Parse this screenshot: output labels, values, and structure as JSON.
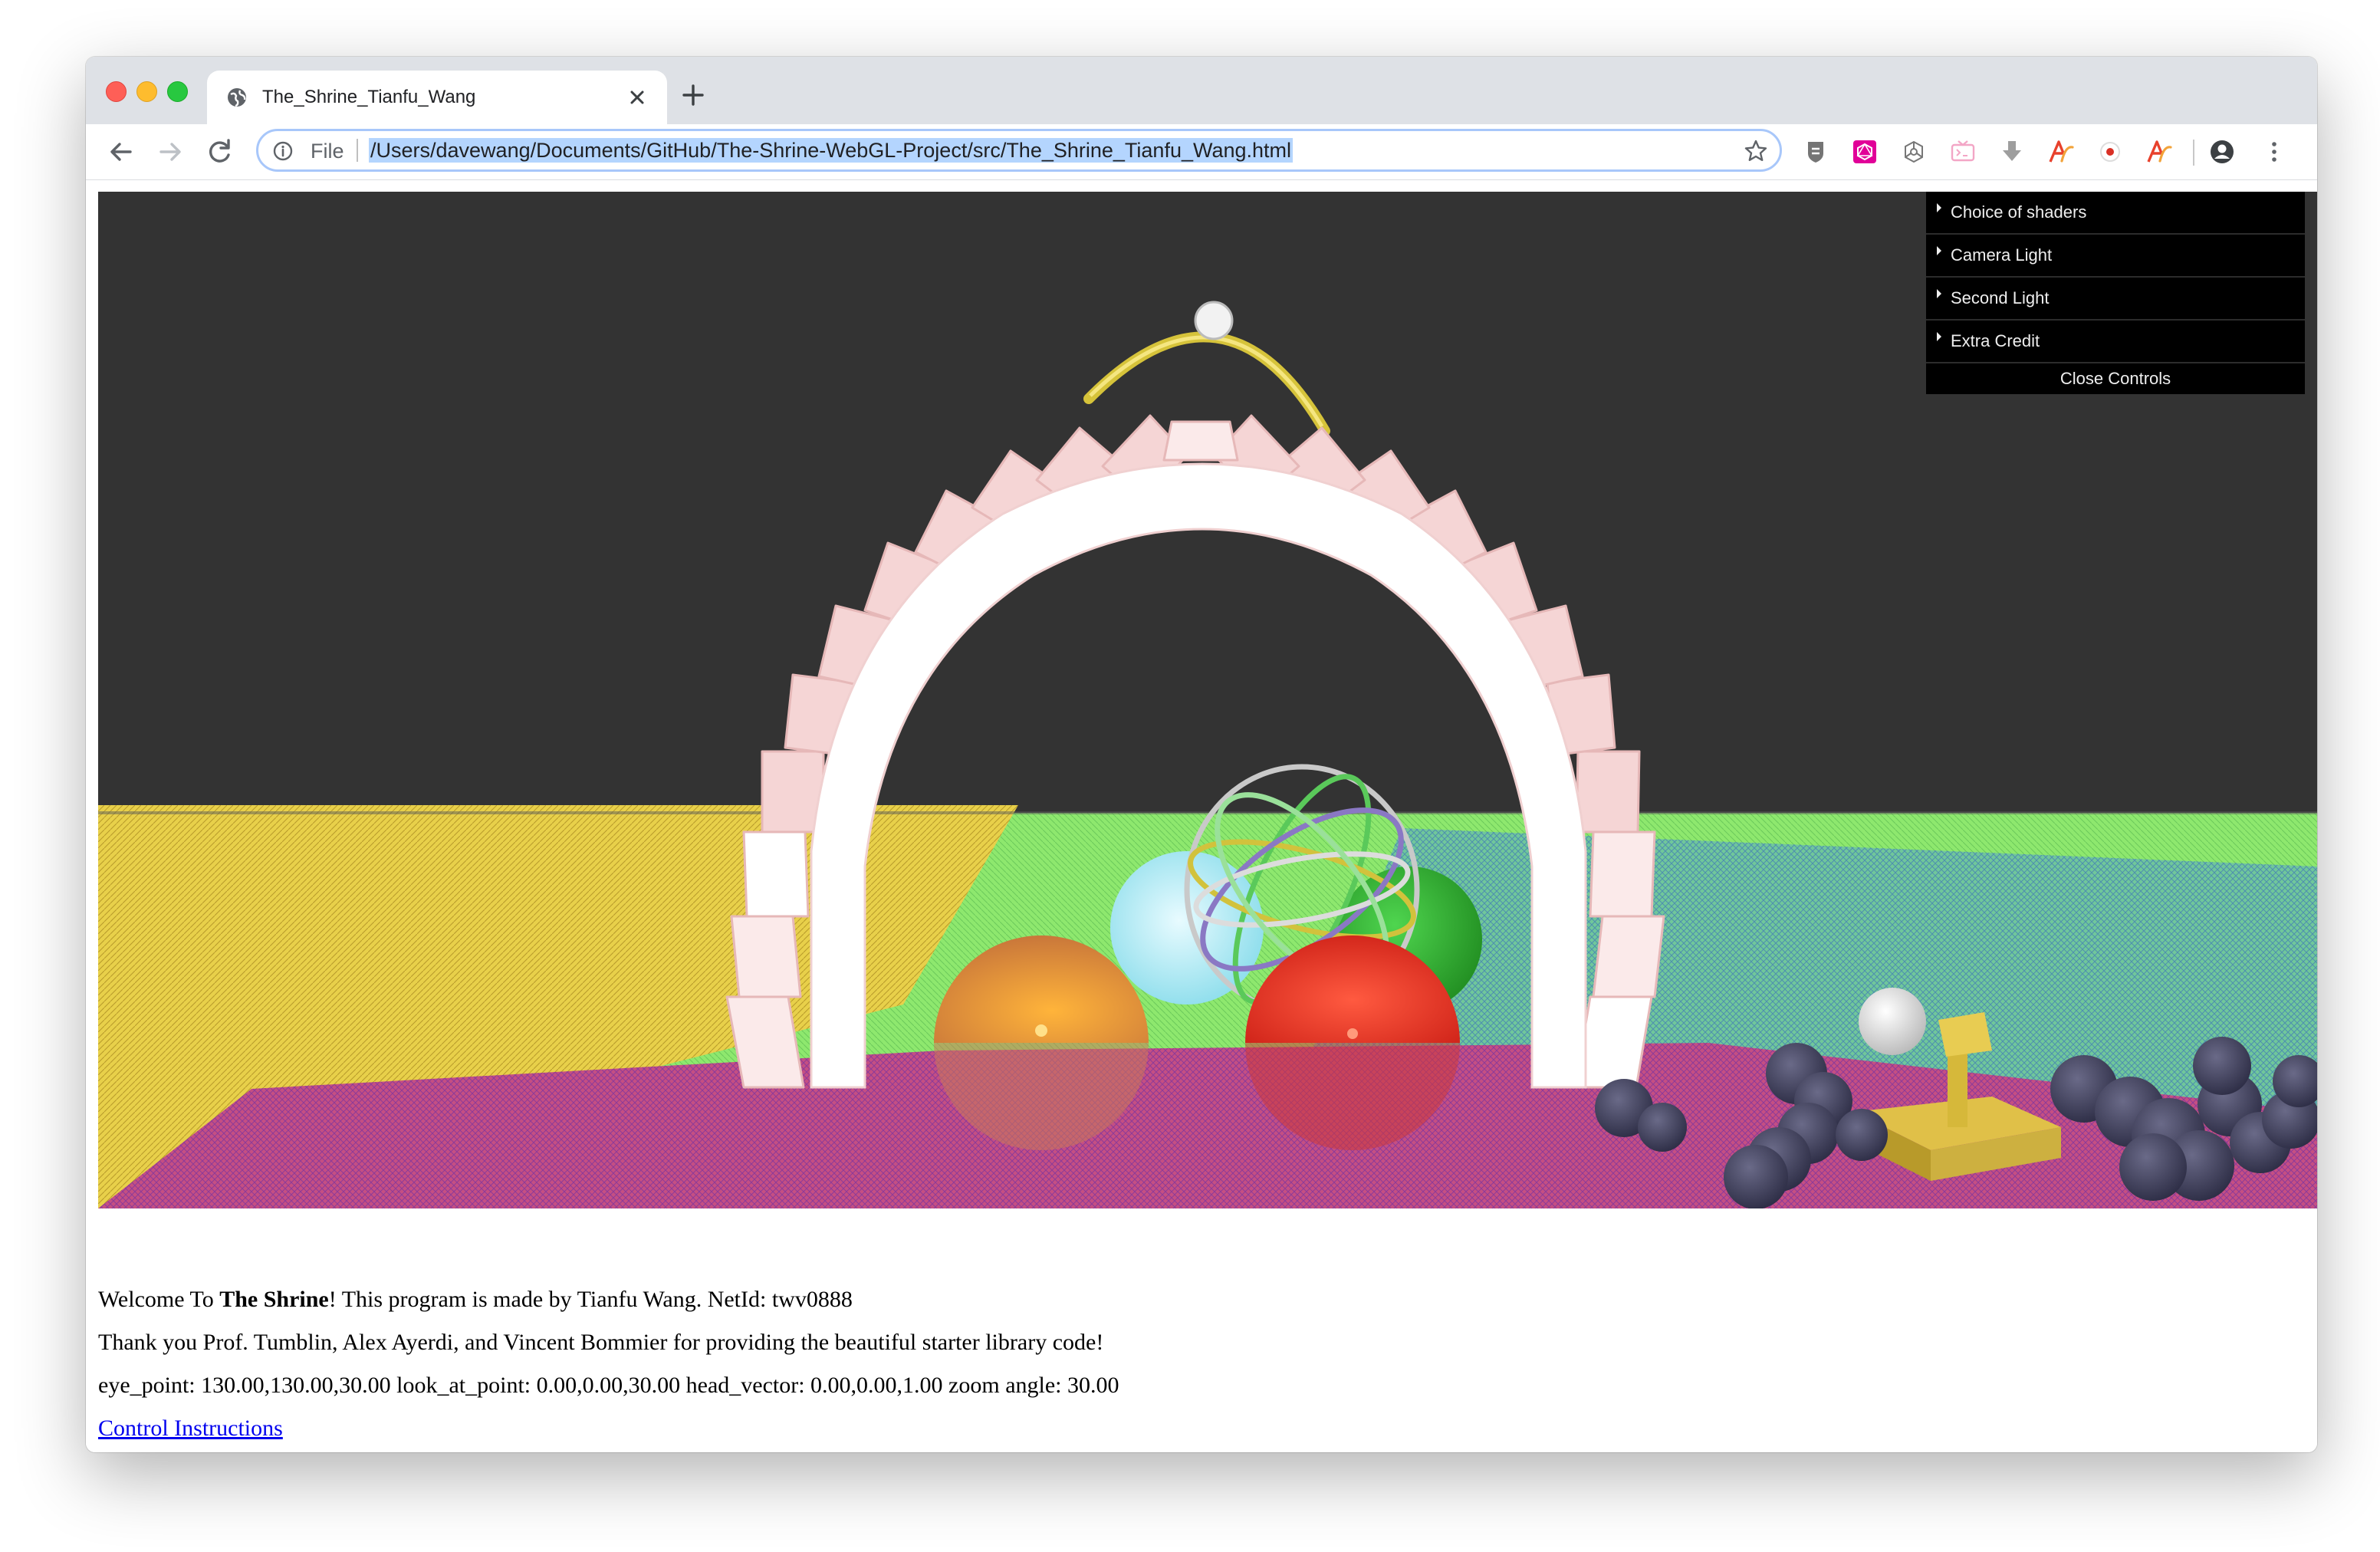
{
  "browser": {
    "tab_title": "The_Shrine_Tianfu_Wang",
    "address_scheme": "File",
    "address_url": "/Users/davewang/Documents/GitHub/The-Shrine-WebGL-Project/src/The_Shrine_Tianfu_Wang.html",
    "icons": {
      "favicon": "globe-icon",
      "tab_close": "close-icon",
      "new_tab": "plus-icon",
      "back": "arrow-left-icon",
      "forward": "arrow-right-icon",
      "reload": "reload-icon",
      "site_info": "info-icon",
      "bookmark": "star-icon",
      "profile": "person-icon",
      "menu": "kebab-menu-icon"
    }
  },
  "gui_panel": {
    "folders": [
      "Choice of shaders",
      "Camera Light",
      "Second Light",
      "Extra Credit"
    ],
    "close_label": "Close Controls"
  },
  "page_text": {
    "welcome_before": "Welcome To ",
    "welcome_bold": "The Shrine",
    "welcome_after": "! This program is made by Tianfu Wang. NetId: twv0888",
    "thanks": "Thank you Prof. Tumblin, Alex Ayerdi, and Vincent Bommier for providing the beautiful starter library code!",
    "camera_status": "eye_point: 130.00,130.00,30.00 look_at_point: 0.00,0.00,30.00 head_vector: 0.00,0.00,1.00 zoom angle: 30.00",
    "instructions_link": "Control Instructions"
  },
  "colors": {
    "canvas_background": "#333333",
    "link": "#0000ee",
    "url_highlight": "#b4d5fe"
  }
}
